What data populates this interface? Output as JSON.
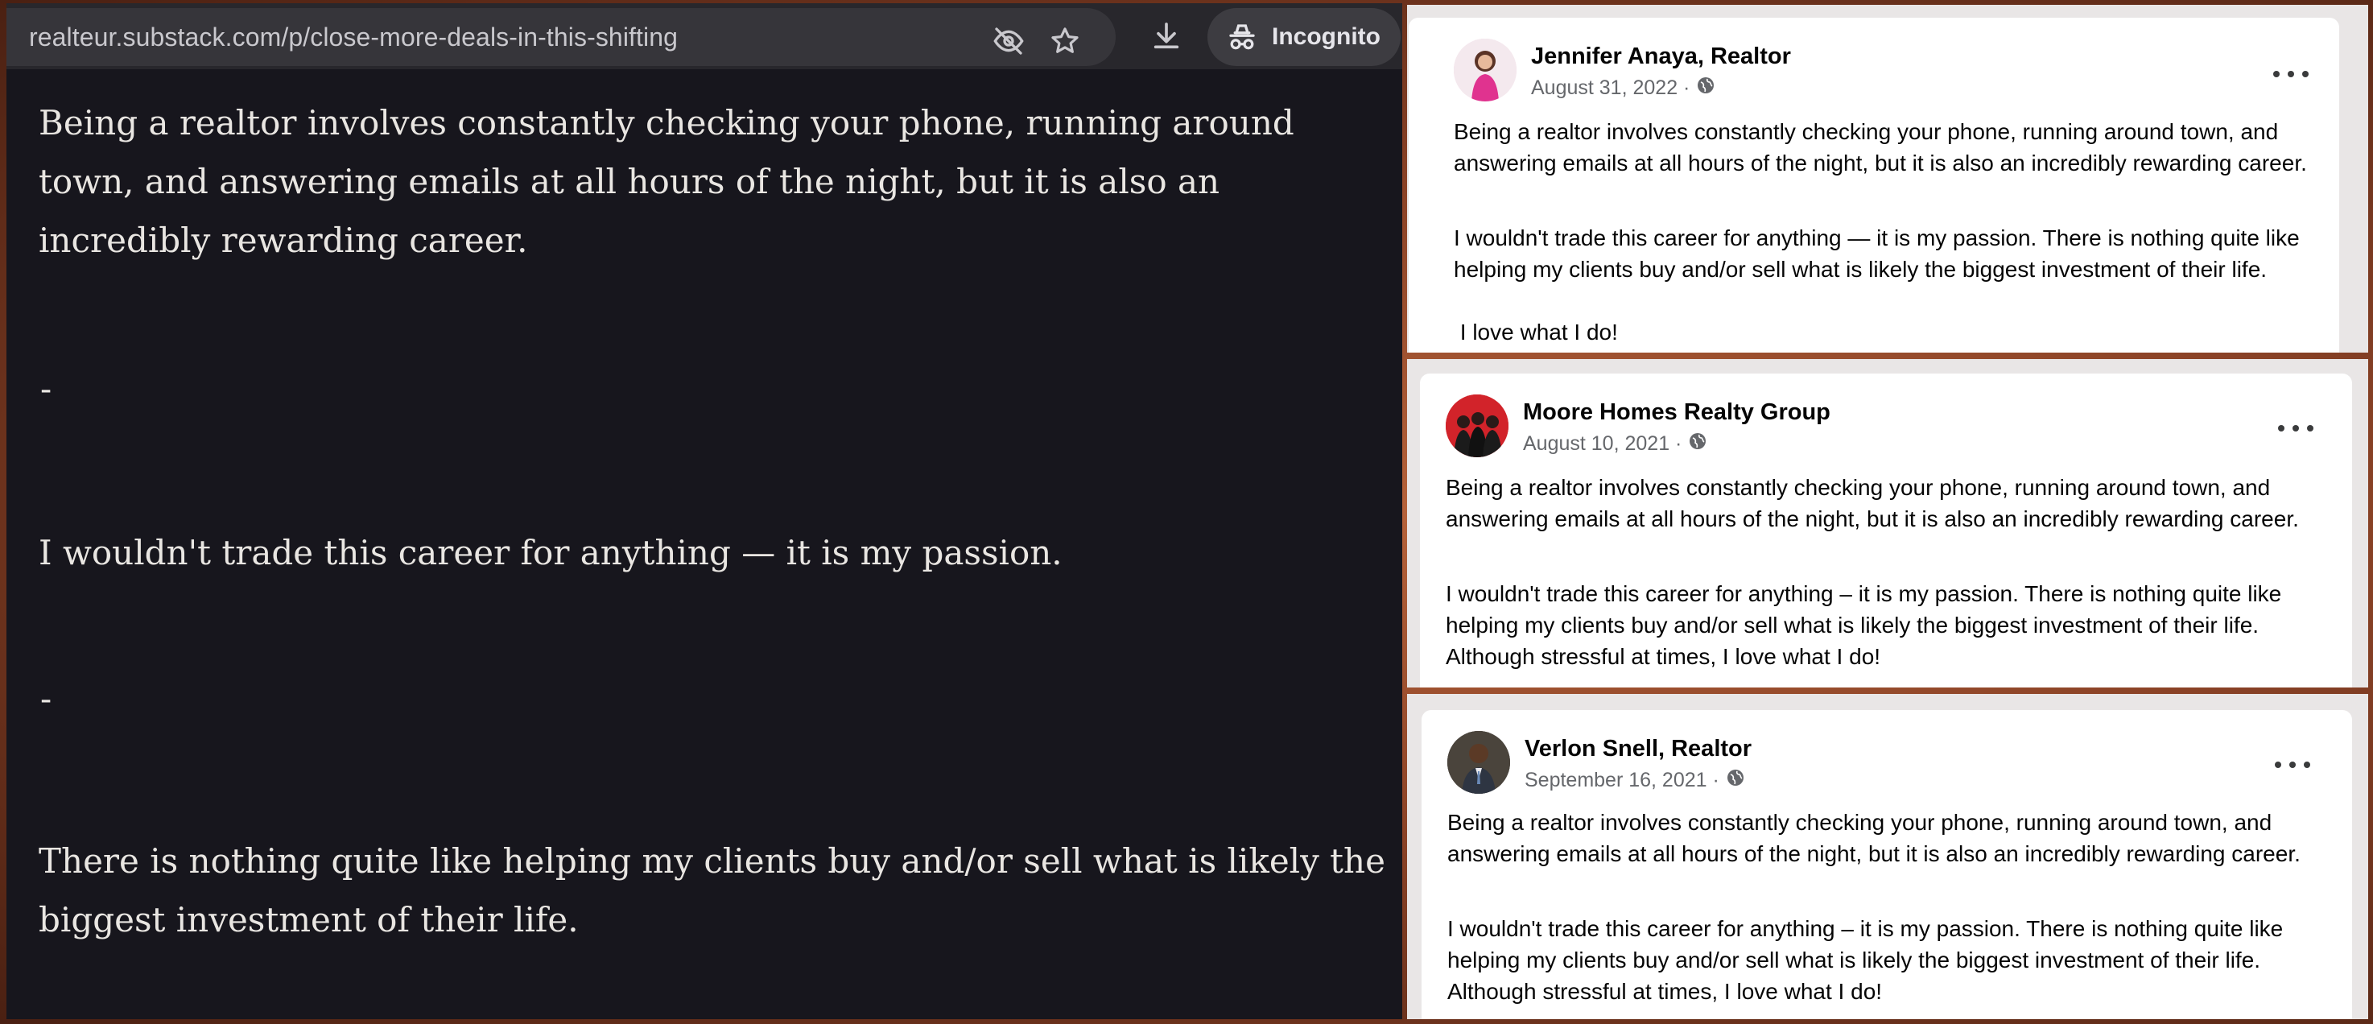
{
  "browser": {
    "url": "realteur.substack.com/p/close-more-deals-in-this-shifting",
    "incognito_label": "Incognito",
    "icons": [
      "eye-off-icon",
      "star-icon",
      "download-icon",
      "incognito-icon"
    ]
  },
  "article": {
    "paragraphs": [
      "Being a realtor involves constantly checking your phone, running around town, and answering emails at all hours of the night, but it is also an incredibly rewarding career.",
      "I wouldn't trade this career for anything — it is my passion.",
      "There is nothing quite like helping my clients buy and/or sell what is likely the biggest investment of their life."
    ],
    "separator": "-"
  },
  "posts": [
    {
      "name": "Jennifer Anaya, Realtor",
      "date": "August 31, 2022 ·",
      "body": [
        "Being a realtor involves constantly checking your phone, running around town, and answering emails at all hours of the night, but it is also an incredibly rewarding career.",
        "I wouldn't trade this career for anything — it is my passion. There is nothing quite like helping my clients buy and/or sell what is likely the biggest investment of their life.",
        " I love what I do!"
      ]
    },
    {
      "name": "Moore Homes Realty Group",
      "date": "August 10, 2021 ·",
      "body": [
        "Being a realtor involves constantly checking your phone, running around town, and answering emails at all hours of the night, but it is also an incredibly rewarding career.",
        "I wouldn't trade this career for anything – it is my passion. There is nothing quite like helping my clients buy and/or sell what is likely the biggest investment of their life. Although stressful at times, I love what I do!"
      ]
    },
    {
      "name": "Verlon Snell, Realtor",
      "date": "September 16, 2021 ·",
      "body": [
        "Being a realtor involves constantly checking your phone, running around town, and answering emails at all hours of the night, but it is also an incredibly rewarding career.",
        "I wouldn't trade this career for anything – it is my passion. There is nothing quite like helping my clients buy and/or sell what is likely the biggest investment of their life. Although stressful at times, I love what I do!"
      ]
    }
  ],
  "colors": {
    "article_bg": "#17161d",
    "article_text": "#e9e6e2",
    "toolbar_bg": "#28272c",
    "frame": "#8a4226",
    "card_bg": "#ffffff",
    "meta_gray": "#65676b"
  }
}
